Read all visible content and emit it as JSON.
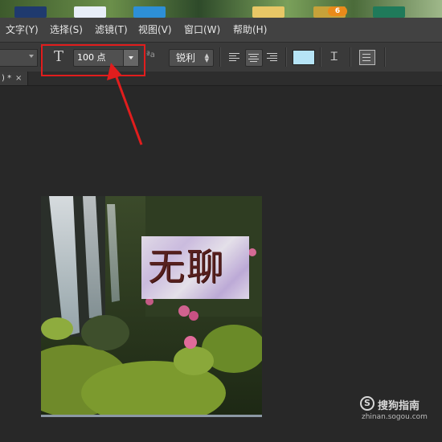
{
  "menubar": {
    "items": [
      "文字(Y)",
      "选择(S)",
      "滤镜(T)",
      "视图(V)",
      "窗口(W)",
      "帮助(H)"
    ]
  },
  "desktop": {
    "badge_count": "6"
  },
  "options": {
    "font_size_value": "100 点",
    "antialias_value": "锐利",
    "text_color": "#b6e4f6"
  },
  "tab": {
    "label": ") *",
    "close": "×"
  },
  "canvas": {
    "text": "无聊"
  },
  "watermark": {
    "brand": "搜狗指南",
    "url": "zhinan.sogou.com"
  },
  "colors": {
    "highlight": "#e11d1d",
    "accent_text": "#5b1e1e"
  },
  "icons": [
    "text-orientation-icon",
    "font-size-icon",
    "align-left-icon",
    "align-center-icon",
    "align-right-icon",
    "warp-text-icon",
    "character-panel-icon",
    "sogou-logo-icon"
  ]
}
